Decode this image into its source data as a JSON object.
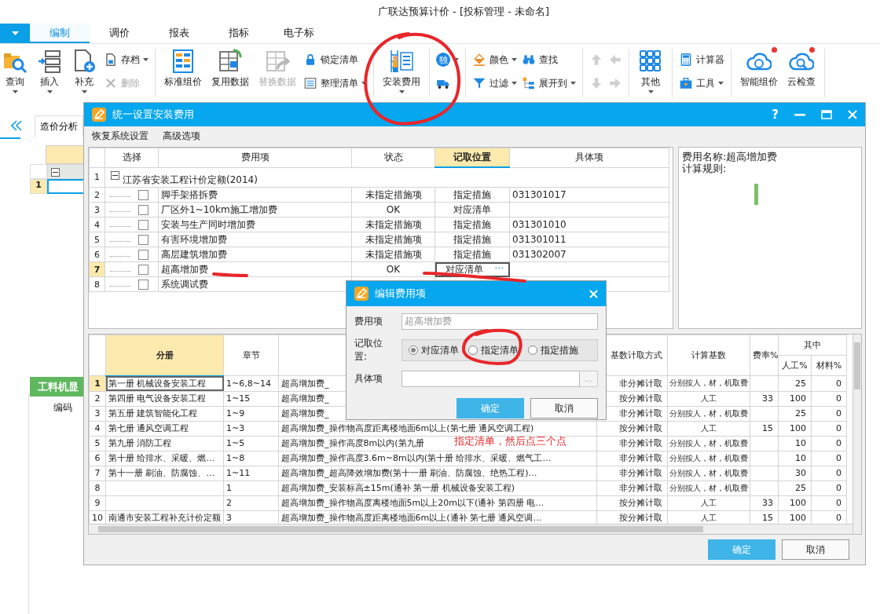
{
  "window": {
    "title": "广联达预算计价 - [投标管理 - 未命名]"
  },
  "menu_tabs": [
    {
      "label": "编制",
      "selected": true
    },
    {
      "label": "调价",
      "selected": false
    },
    {
      "label": "报表",
      "selected": false
    },
    {
      "label": "指标",
      "selected": false
    },
    {
      "label": "电子标",
      "selected": false
    }
  ],
  "ribbon": [
    [
      {
        "kind": "large",
        "label": "查询",
        "dropdown": true,
        "disabled": false
      },
      {
        "kind": "large",
        "label": "插入",
        "dropdown": true,
        "disabled": false
      },
      {
        "kind": "large",
        "label": "补充",
        "dropdown": true,
        "disabled": false
      },
      {
        "kind": "stack",
        "items": [
          {
            "label": "存档",
            "dropdown": true,
            "disabled": false
          },
          {
            "label": "删除",
            "dropdown": false,
            "disabled": true
          }
        ]
      }
    ],
    [
      {
        "kind": "large",
        "label": "标准组价",
        "dropdown": false,
        "disabled": false
      },
      {
        "kind": "large",
        "label": "复用数据",
        "dropdown": false,
        "disabled": false
      },
      {
        "kind": "large",
        "label": "替换数据",
        "dropdown": false,
        "disabled": true
      },
      {
        "kind": "stack",
        "items": [
          {
            "label": "锁定清单",
            "dropdown": false,
            "disabled": false
          },
          {
            "label": "整理清单",
            "dropdown": true,
            "disabled": false
          }
        ]
      }
    ],
    [
      {
        "kind": "large",
        "label": "安装费用",
        "dropdown": true,
        "disabled": false
      }
    ],
    [
      {
        "kind": "stack",
        "items": [
          {
            "glyph": "独",
            "dropdown": true,
            "disabled": false
          },
          {
            "dropdown": false,
            "disabled": false
          }
        ]
      }
    ],
    [
      {
        "kind": "stack",
        "items": [
          {
            "label": "颜色",
            "dropdown": true,
            "disabled": false
          },
          {
            "label": "过滤",
            "dropdown": true,
            "disabled": false
          }
        ]
      },
      {
        "kind": "stack",
        "items": [
          {
            "label": "查找",
            "dropdown": false,
            "disabled": false
          },
          {
            "label": "展开到",
            "dropdown": true,
            "disabled": false
          }
        ]
      }
    ],
    [
      {
        "kind": "stack",
        "items": [
          {
            "dropdown": false,
            "disabled": true
          },
          {
            "dropdown": false,
            "disabled": true
          }
        ]
      },
      {
        "kind": "stack",
        "items": [
          {
            "dropdown": false,
            "disabled": true
          },
          {
            "dropdown": false,
            "disabled": true
          }
        ]
      }
    ],
    [
      {
        "kind": "large",
        "label": "其他",
        "dropdown": true,
        "disabled": false
      }
    ],
    [
      {
        "kind": "stack",
        "items": [
          {
            "label": "计算器",
            "dropdown": false,
            "disabled": false
          },
          {
            "label": "工具",
            "dropdown": true,
            "disabled": false
          }
        ]
      }
    ],
    [
      {
        "kind": "large",
        "label": "智能组价",
        "dropdown": false,
        "disabled": false,
        "notification": true
      },
      {
        "kind": "large",
        "label": "云检查",
        "dropdown": false,
        "disabled": false,
        "notification": true
      }
    ]
  ],
  "side_tabs": [
    {
      "label": "造价分析",
      "selected": true
    }
  ],
  "left_grid": {
    "expanded": true,
    "rows": [
      {
        "number": "1",
        "selected": true
      }
    ]
  },
  "lower_tabs": [
    {
      "label": "工料机显",
      "selected": true
    }
  ],
  "lower_columns": [
    "编码"
  ],
  "dialog": {
    "title": "统一设置安装费用",
    "help": "?",
    "menu": [
      "恢复系统设置",
      "高级选项"
    ],
    "top_table": {
      "columns": [
        {
          "label": "选择",
          "selected": false
        },
        {
          "label": "费用项",
          "selected": false
        },
        {
          "label": "状态",
          "selected": false
        },
        {
          "label": "记取位置",
          "selected": true
        },
        {
          "label": "具体项",
          "selected": false
        }
      ],
      "group": {
        "number": "1",
        "label": "江苏省安装工程计价定额(2014)",
        "expanded": true
      },
      "cell_button": "···",
      "rows": [
        {
          "number": "2",
          "checked": false,
          "selected": false,
          "name": "脚手架搭拆费",
          "status": "未指定措施项",
          "position": "指定措施",
          "item": "031301017"
        },
        {
          "number": "3",
          "checked": false,
          "selected": false,
          "name": "厂区外1~10km施工增加费",
          "status": "OK",
          "position": "对应清单"
        },
        {
          "number": "4",
          "checked": false,
          "selected": false,
          "name": "安装与生产同时增加费",
          "status": "未指定措施项",
          "position": "指定措施",
          "item": "031301010"
        },
        {
          "number": "5",
          "checked": false,
          "selected": false,
          "name": "有害环境增加费",
          "status": "未指定措施项",
          "position": "指定措施",
          "item": "031301011"
        },
        {
          "number": "6",
          "checked": false,
          "selected": false,
          "name": "高层建筑增加费",
          "status": "未指定措施项",
          "position": "指定措施",
          "item": "031302007"
        },
        {
          "number": "7",
          "checked": false,
          "selected": true,
          "name": "超高增加费",
          "status": "OK",
          "position": "对应清单"
        },
        {
          "number": "8",
          "checked": false,
          "selected": false,
          "name": "系统调试费"
        }
      ]
    },
    "info": [
      "费用名称:超高增加费",
      "计算规则:"
    ],
    "bottom_table": {
      "columns": [
        {
          "label": "分册",
          "selected": true
        },
        {
          "label": "章节",
          "selected": false
        },
        {
          "selected": false
        },
        {
          "label": "基数计取方式",
          "selected": false
        },
        {
          "label": "计算基数",
          "selected": false
        },
        {
          "label": "费率%",
          "selected": false
        }
      ],
      "column_group": {
        "label": "其中",
        "columns": [
          "人工%",
          "材料%"
        ]
      },
      "rows": [
        {
          "number": "1",
          "selected": true,
          "volume": "第一册 机械设备安装工程",
          "chapter": "1~6,8~14",
          "name": "超高增加费_",
          "method": "非分摊计取",
          "base": "分别按人，材，机取费",
          "labor": "25",
          "material": "0"
        },
        {
          "number": "2",
          "selected": false,
          "volume": "第四册 电气设备安装工程",
          "chapter": "1~15",
          "name": "超高增加费_",
          "method": "按分摊计取",
          "base": "人工",
          "rate": "33",
          "labor": "100",
          "material": "0"
        },
        {
          "number": "3",
          "selected": false,
          "volume": "第五册 建筑智能化工程",
          "chapter": "1~9",
          "name": "超高增加费_",
          "method": "非分摊计取",
          "base": "分别按人，材，机取费",
          "labor": "25",
          "material": "0"
        },
        {
          "number": "4",
          "selected": false,
          "volume": "第七册 通风空调工程",
          "chapter": "1~3",
          "name": "超高增加费_操作物高度距离楼地面6m以上(第七册 通风空调工程)",
          "method": "按分摊计取",
          "base": "人工",
          "rate": "15",
          "labor": "100",
          "material": "0"
        },
        {
          "number": "5",
          "selected": false,
          "volume": "第九册 消防工程",
          "chapter": "1~5",
          "name": "超高增加费_操作高度8m以内(第九册",
          "method": "非分摊计取",
          "base": "分别按人，材，机取费",
          "labor": "10",
          "material": "0"
        },
        {
          "number": "6",
          "selected": false,
          "volume": "第十册 给排水、采暖、燃…",
          "chapter": "1~8",
          "name": "超高增加费_操作高度3.6m~8m以内(第十册 给排水、采暖、燃气工…",
          "method": "非分摊计取",
          "base": "分别按人，材，机取费",
          "labor": "10",
          "material": "0"
        },
        {
          "number": "7",
          "selected": false,
          "volume": "第十一册 刷油、防腐蚀、…",
          "chapter": "1~11",
          "name": "超高增加费_超高降效增加费(第十一册 刷油、防腐蚀、绝热工程)…",
          "method": "非分摊计取",
          "base": "分别按人，材，机取费",
          "labor": "30",
          "material": "0"
        },
        {
          "number": "8",
          "selected": false,
          "chapter": "1",
          "name": "超高增加费_安装标高±15m(通补 第一册 机械设备安装工程)",
          "method": "非分摊计取",
          "base": "分别按人，材，机取费",
          "labor": "25",
          "material": "0"
        },
        {
          "number": "9",
          "selected": false,
          "chapter": "2",
          "name": "超高增加费_操作物高度离楼地面5m以上20m以下(通补 第四册 电…",
          "method": "按分摊计取",
          "base": "人工",
          "rate": "33",
          "labor": "100",
          "material": "0"
        },
        {
          "number": "10",
          "selected": false,
          "volume": "南通市安装工程补充计价定额",
          "chapter": "3",
          "name": "超高增加费_操作物高度距离楼地面6m以上(通补 第七册 通风空调…",
          "method": "按分摊计取",
          "base": "人工",
          "rate": "15",
          "labor": "100",
          "material": "0"
        }
      ]
    },
    "buttons": [
      {
        "label": "确定",
        "kind": "primary"
      },
      {
        "label": "取消",
        "kind": "secondary"
      }
    ]
  },
  "edit_dialog": {
    "title": "编辑费用项",
    "name_label": "费用项",
    "name_value": "超高增加费",
    "name_disabled": true,
    "position_label": "记取位置:",
    "options": [
      {
        "label": "对应清单",
        "selected": true
      },
      {
        "label": "指定清单",
        "selected": false
      },
      {
        "label": "指定措施",
        "selected": false
      }
    ],
    "item_label": "具体项",
    "browse": "...",
    "buttons": [
      {
        "label": "确定",
        "kind": "primary"
      },
      {
        "label": "取消",
        "kind": "secondary"
      }
    ]
  },
  "annotation": {
    "text": "指定清单，然后点三个点"
  }
}
